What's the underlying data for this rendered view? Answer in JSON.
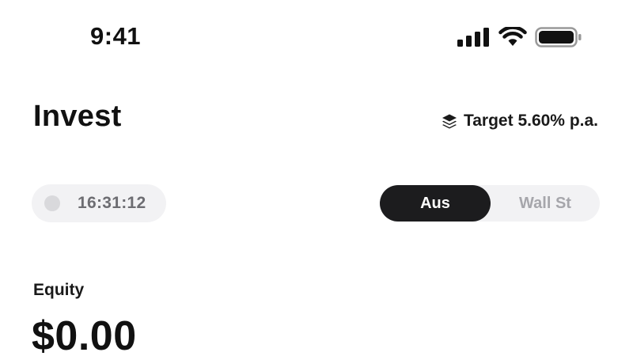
{
  "status_bar": {
    "time": "9:41",
    "icons": [
      "cellular-signal-icon",
      "wifi-icon",
      "battery-icon"
    ]
  },
  "header": {
    "title": "Invest",
    "target_icon": "layers-icon",
    "target_label": "Target 5.60% p.a."
  },
  "market_clock": {
    "time": "16:31:12",
    "status_color": "#d9d9dc"
  },
  "market_toggle": {
    "options": [
      {
        "label": "Aus",
        "selected": true
      },
      {
        "label": "Wall St",
        "selected": false
      }
    ]
  },
  "equity": {
    "label": "Equity",
    "value": "$0.00"
  },
  "colors": {
    "active_segment": "#1c1c1e",
    "pill_background": "#f2f2f4",
    "inactive_text": "#a6a6ab"
  }
}
